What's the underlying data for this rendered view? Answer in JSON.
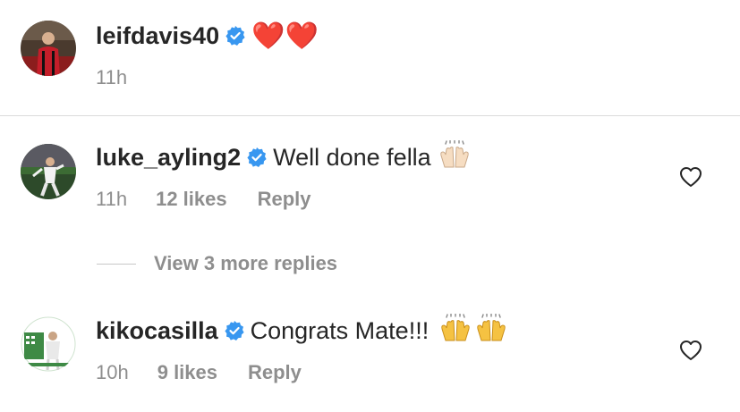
{
  "colors": {
    "verified_blue": "#3897f0",
    "text_primary": "#262626",
    "text_secondary": "#8e8e8e",
    "divider": "#dbdbdb"
  },
  "post": {
    "username": "leifdavis40",
    "verified": true,
    "caption": "❤️❤️",
    "time": "11h"
  },
  "comments": [
    {
      "username": "luke_ayling2",
      "verified": true,
      "text": "Well done fella",
      "emoji": "🙌",
      "emoji_count": 1,
      "time": "11h",
      "likes": "12 likes",
      "reply_label": "Reply",
      "like_icon": "heart-outline-icon"
    },
    {
      "username": "kikocasilla",
      "verified": true,
      "text": "Congrats Mate!!!",
      "emoji": "🙌🙌",
      "emoji_count": 2,
      "time": "10h",
      "likes": "9 likes",
      "reply_label": "Reply",
      "like_icon": "heart-outline-icon"
    }
  ],
  "view_replies_label": "View 3 more replies"
}
